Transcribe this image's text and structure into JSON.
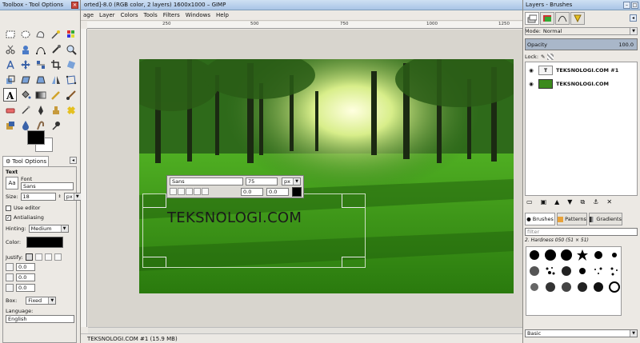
{
  "toolbox": {
    "title": "Toolbox - Tool Options",
    "tab_label": "Tool Options",
    "section_text": "Text",
    "font_label": "Font",
    "font_value": "Sans",
    "font_icon_text": "Aa",
    "size_label": "Size:",
    "size_value": "18",
    "size_unit": "px",
    "use_editor_label": "Use editor",
    "antialiasing_label": "Antialiasing",
    "hinting_label": "Hinting:",
    "hinting_value": "Medium",
    "color_label": "Color:",
    "justify_label": "Justify:",
    "indent_value": "0.0",
    "line_spacing_value": "0.0",
    "letter_spacing_value": "0.0",
    "box_label": "Box:",
    "box_value": "Fixed",
    "language_label": "Language:",
    "language_value": "English",
    "fg_color": "#000000",
    "bg_color": "#ffffff"
  },
  "image_window": {
    "title": "orted]-8.0 (RGB color, 2 layers) 1600x1000 – GIMP",
    "menu": [
      "age",
      "Layer",
      "Colors",
      "Tools",
      "Filters",
      "Windows",
      "Help"
    ],
    "ruler_labels": [
      "250",
      "500",
      "750",
      "1000",
      "1250",
      "1500"
    ],
    "status_text": "TEKSNOLOGI.COM #1 (15.9 MB)",
    "canvas_text": "TEKSNOLOGI.COM",
    "text_bar": {
      "font_value": "Sans",
      "size_value": "75",
      "unit_value": "px",
      "baseline_value": "0.0",
      "kerning_value": "0.0"
    }
  },
  "dock": {
    "title": "Layers - Brushes",
    "mode_label": "Mode:",
    "mode_value": "Normal",
    "opacity_label": "Opacity",
    "opacity_value": "100.0",
    "lock_label": "Lock:",
    "layers": [
      {
        "name": "TEKSNOLOGI.COM #1"
      },
      {
        "name": "TEKSNOLOGI.COM"
      }
    ],
    "brush_tabs": [
      "Brushes",
      "Patterns",
      "Gradients"
    ],
    "filter_placeholder": "filter",
    "brush_name": "2. Hardness 050 (51 × 51)",
    "preset_value": "Basic"
  }
}
